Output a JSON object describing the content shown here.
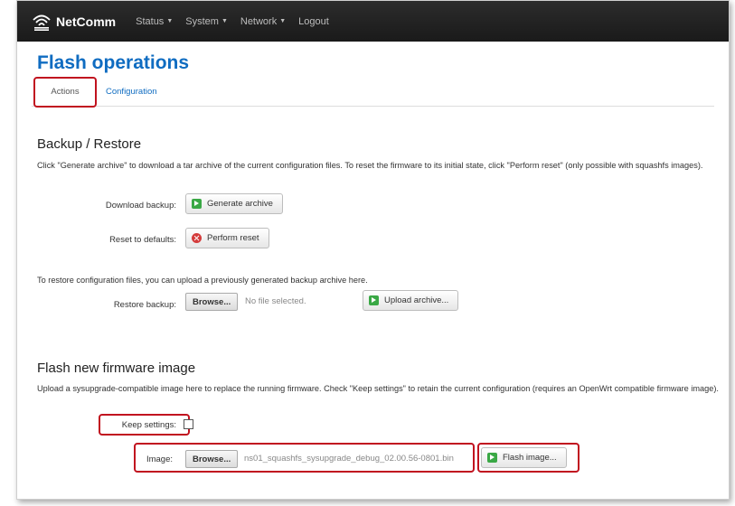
{
  "navbar": {
    "brand": "NetComm",
    "items": [
      {
        "label": "Status",
        "dropdown": true
      },
      {
        "label": "System",
        "dropdown": true
      },
      {
        "label": "Network",
        "dropdown": true
      },
      {
        "label": "Logout",
        "dropdown": false
      }
    ]
  },
  "page": {
    "title": "Flash operations",
    "tabs": [
      {
        "label": "Actions",
        "active": true
      },
      {
        "label": "Configuration",
        "active": false
      }
    ]
  },
  "backup": {
    "title": "Backup / Restore",
    "description": "Click \"Generate archive\" to download a tar archive of the current configuration files. To reset the firmware to its initial state, click \"Perform reset\" (only possible with squashfs images).",
    "download_label": "Download backup:",
    "generate_button": "Generate archive",
    "reset_label": "Reset to defaults:",
    "reset_button": "Perform reset",
    "restore_description": "To restore configuration files, you can upload a previously generated backup archive here.",
    "restore_label": "Restore backup:",
    "browse_button": "Browse...",
    "file_status": "No file selected.",
    "upload_button": "Upload archive..."
  },
  "flash": {
    "title": "Flash new firmware image",
    "description": "Upload a sysupgrade-compatible image here to replace the running firmware. Check \"Keep settings\" to retain the current configuration (requires an OpenWrt compatible firmware image).",
    "keep_settings_label": "Keep settings:",
    "keep_settings_checked": false,
    "image_label": "Image:",
    "browse_button": "Browse...",
    "file_name": "ns01_squashfs_sysupgrade_debug_02.00.56-0801.bin",
    "flash_button": "Flash image..."
  },
  "colors": {
    "accent": "#0f6cc1",
    "highlight": "#c1121f",
    "navbar": "#1f1f1f"
  }
}
